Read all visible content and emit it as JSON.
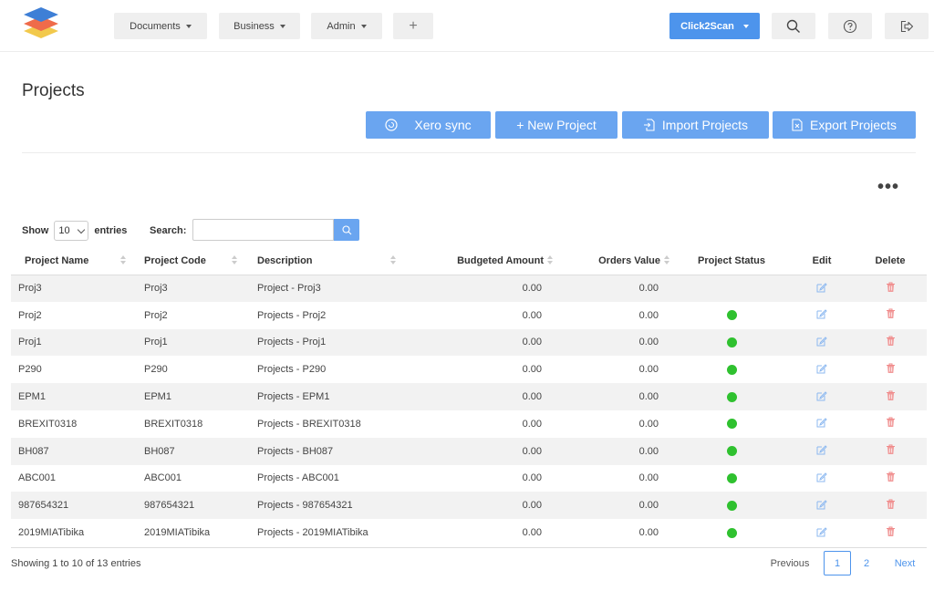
{
  "nav": {
    "documents": "Documents",
    "business": "Business",
    "admin": "Admin",
    "add": "+",
    "click2scan": "Click2Scan"
  },
  "page": {
    "title": "Projects"
  },
  "actions": {
    "xero_sync": "Xero sync",
    "new_project": "+ New Project",
    "import_projects": "Import Projects",
    "export_projects": "Export Projects"
  },
  "table_controls": {
    "show_label": "Show",
    "entries_value": "10",
    "entries_label": "entries",
    "search_label": "Search:",
    "search_value": ""
  },
  "columns": [
    "Project Name",
    "Project Code",
    "Description",
    "Budgeted Amount",
    "Orders Value",
    "Project Status",
    "Edit",
    "Delete"
  ],
  "rows": [
    {
      "name": "Proj3",
      "code": "Proj3",
      "desc": "Project - Proj3",
      "budget": "0.00",
      "orders": "0.00",
      "status": "none"
    },
    {
      "name": "Proj2",
      "code": "Proj2",
      "desc": "Projects - Proj2",
      "budget": "0.00",
      "orders": "0.00",
      "status": "active"
    },
    {
      "name": "Proj1",
      "code": "Proj1",
      "desc": "Projects - Proj1",
      "budget": "0.00",
      "orders": "0.00",
      "status": "active"
    },
    {
      "name": "P290",
      "code": "P290",
      "desc": "Projects - P290",
      "budget": "0.00",
      "orders": "0.00",
      "status": "active"
    },
    {
      "name": "EPM1",
      "code": "EPM1",
      "desc": "Projects - EPM1",
      "budget": "0.00",
      "orders": "0.00",
      "status": "active"
    },
    {
      "name": "BREXIT0318",
      "code": "BREXIT0318",
      "desc": "Projects - BREXIT0318",
      "budget": "0.00",
      "orders": "0.00",
      "status": "active"
    },
    {
      "name": "BH087",
      "code": "BH087",
      "desc": "Projects - BH087",
      "budget": "0.00",
      "orders": "0.00",
      "status": "active"
    },
    {
      "name": "ABC001",
      "code": "ABC001",
      "desc": "Projects - ABC001",
      "budget": "0.00",
      "orders": "0.00",
      "status": "active"
    },
    {
      "name": "987654321",
      "code": "987654321",
      "desc": "Projects - 987654321",
      "budget": "0.00",
      "orders": "0.00",
      "status": "active"
    },
    {
      "name": "2019MIATibika",
      "code": "2019MIATibika",
      "desc": "Projects - 2019MIATibika",
      "budget": "0.00",
      "orders": "0.00",
      "status": "active"
    }
  ],
  "footer": {
    "info": "Showing 1 to 10 of 13 entries",
    "previous": "Previous",
    "page1": "1",
    "page2": "2",
    "next": "Next"
  },
  "colors": {
    "primary": "#4d94ec",
    "action": "#6aa5f0",
    "status_active": "#2fc12f",
    "edit_icon": "#8cb8f0",
    "delete_icon": "#f08a8a"
  },
  "icons": {
    "xero": "refresh-circle-icon",
    "import": "import-file-icon",
    "export": "export-file-icon",
    "edit": "edit-icon",
    "delete": "trash-icon"
  }
}
